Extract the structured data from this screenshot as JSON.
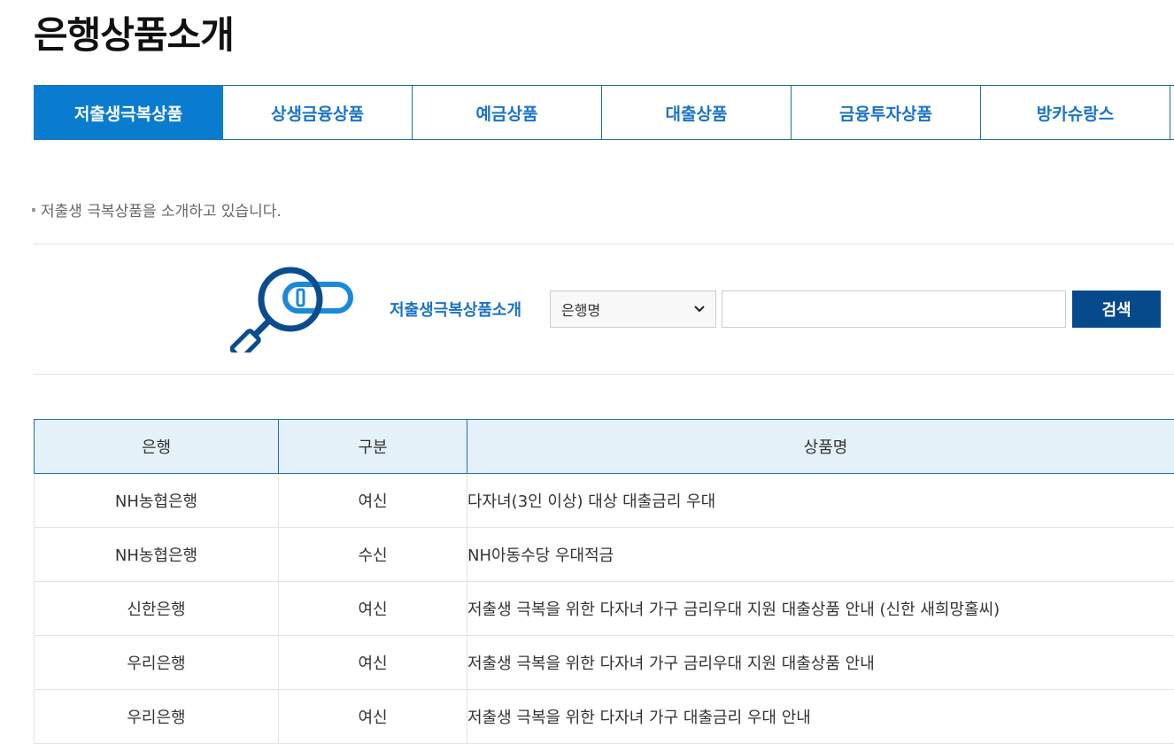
{
  "page_title": "은행상품소개",
  "tabs": [
    {
      "label": "저출생극복상품",
      "active": true
    },
    {
      "label": "상생금융상품",
      "active": false
    },
    {
      "label": "예금상품",
      "active": false
    },
    {
      "label": "대출상품",
      "active": false
    },
    {
      "label": "금융투자상품",
      "active": false
    },
    {
      "label": "방카슈랑스",
      "active": false
    }
  ],
  "description": "저출생 극복상품을 소개하고 있습니다.",
  "search": {
    "label": "저출생극복상품소개",
    "select_value": "은행명",
    "input_value": "",
    "button_label": "검색"
  },
  "table": {
    "headers": [
      "은행",
      "구분",
      "상품명"
    ],
    "rows": [
      {
        "bank": "NH농협은행",
        "type": "여신",
        "product": "다자녀(3인 이상) 대상 대출금리 우대"
      },
      {
        "bank": "NH농협은행",
        "type": "수신",
        "product": "NH아동수당 우대적금"
      },
      {
        "bank": "신한은행",
        "type": "여신",
        "product": "저출생 극복을 위한 다자녀 가구 금리우대 지원 대출상품 안내 (신한 새희망홀씨)"
      },
      {
        "bank": "우리은행",
        "type": "여신",
        "product": "저출생 극복을 위한 다자녀 가구 금리우대 지원 대출상품 안내"
      },
      {
        "bank": "우리은행",
        "type": "여신",
        "product": "저출생 극복을 위한 다자녀 가구 대출금리 우대 안내"
      }
    ]
  },
  "colors": {
    "accent": "#0a7cd0",
    "tab_text": "#1a73c6",
    "button": "#074a8c",
    "table_header_bg": "#e4f1f8"
  },
  "icons": {
    "search_illustration": "magnifier-with-card-icon",
    "select_chevron": "chevron-down-icon"
  }
}
